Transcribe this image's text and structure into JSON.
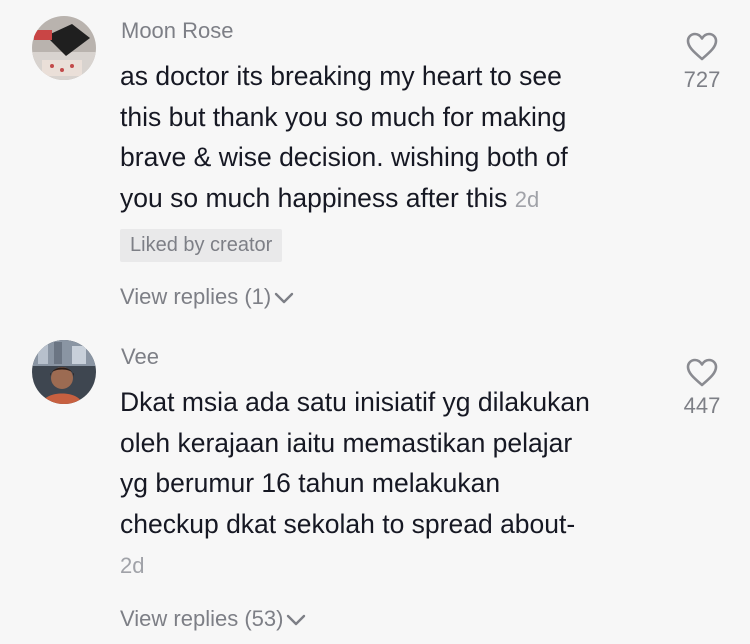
{
  "comments": [
    {
      "username": "Moon Rose",
      "text": "as doctor its breaking my heart to see\nthis but thank you so much for making\nbrave & wise decision. wishing both of\nyou so much happiness after this ",
      "time": "2d",
      "badge": "Liked by creator",
      "like_count": "727",
      "view_replies": "View replies (1)",
      "avatar_icon": "avatar-photo"
    },
    {
      "username": "Vee",
      "text": "Dkat msia ada satu inisiatif yg dilakukan\noleh kerajaan iaitu memastikan pelajar\nyg berumur 16 tahun melakukan\ncheckup dkat sekolah to spread about-\n",
      "time": "2d",
      "like_count": "447",
      "view_replies": "View replies (53)",
      "avatar_icon": "avatar-photo"
    }
  ],
  "icons": {
    "like": "heart-outline-icon",
    "expand": "chevron-down-icon"
  },
  "colors": {
    "background": "#f7f7f7",
    "primary_text": "#161823",
    "secondary_text": "#7d7f86",
    "badge_bg": "#e9e9ea"
  }
}
